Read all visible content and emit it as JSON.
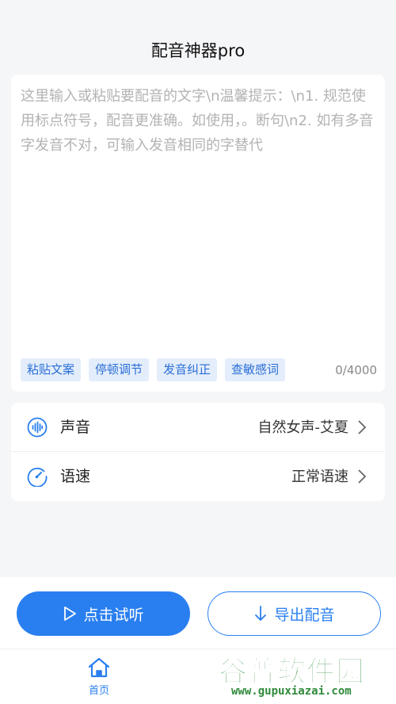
{
  "header": {
    "title": "配音神器pro"
  },
  "editor": {
    "placeholder": "这里输入或粘贴要配音的文字\\n温馨提示：\\n1. 规范使用标点符号，配音更准确。如使用，。断句\\n2. 如有多音字发音不对，可输入发音相同的字替代",
    "chips": [
      "粘贴文案",
      "停顿调节",
      "发音纠正",
      "查敏感词"
    ],
    "counter": "0/4000"
  },
  "settings": {
    "voice": {
      "label": "声音",
      "value": "自然女声-艾夏",
      "icon": "sound-wave-icon"
    },
    "speed": {
      "label": "语速",
      "value": "正常语速",
      "icon": "speedometer-icon"
    }
  },
  "actions": {
    "play": {
      "label": "点击试听",
      "icon": "play-icon"
    },
    "export": {
      "label": "导出配音",
      "icon": "arrow-down-icon"
    }
  },
  "nav": {
    "home": {
      "label": "首页",
      "icon": "home-icon"
    }
  },
  "watermark": {
    "title": "谷普软件园",
    "url": "www.gupuxiazai.com"
  },
  "colors": {
    "accent": "#2a7ff0",
    "chip_bg": "#e3edfb",
    "watermark": "#2f8a3a"
  }
}
